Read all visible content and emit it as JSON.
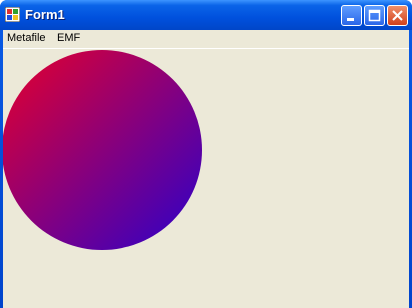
{
  "window": {
    "title": "Form1"
  },
  "menu": {
    "items": [
      "Metafile",
      "EMF"
    ]
  },
  "drawing": {
    "shape": "circle",
    "gradient_start": "#e8002a",
    "gradient_end": "#2a00cc"
  },
  "colors": {
    "titlebar": "#0050dd",
    "client_background": "#ece9d8",
    "close_button": "#d2411c"
  }
}
